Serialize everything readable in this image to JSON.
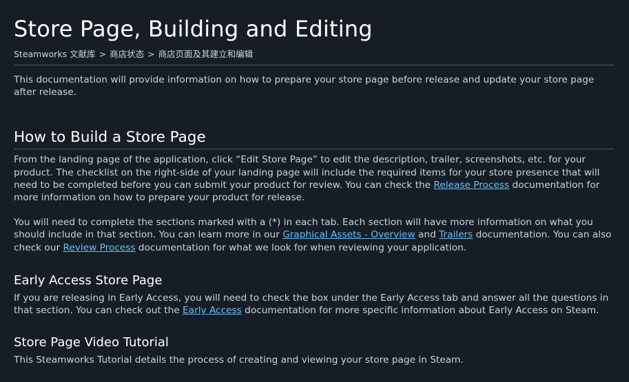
{
  "page": {
    "title": "Store Page, Building and Editing",
    "breadcrumb": [
      {
        "label": "Steamworks 文献库"
      },
      {
        "label": "商店状态"
      },
      {
        "label": "商店页面及其建立和编辑"
      }
    ],
    "breadcrumb_separator": ">",
    "intro": "This documentation will provide information on how to prepare your store page before release and update your store page after release."
  },
  "section_build": {
    "heading": "How to Build a Store Page",
    "p1_before": "From the landing page of the application, click “Edit Store Page” to edit the description, trailer, screenshots, etc. for your product. The checklist on the right-side of your landing page will include the required items for your store presence that will need to be completed before you can submit your product for review. You can check the ",
    "p1_link": "Release Process",
    "p1_after": " documentation for more information on how to prepare your product for release.",
    "p2_a": "You will need to complete the sections marked with a (*) in each tab. Each section will have more information on what you should include in that section. You can learn more in our ",
    "p2_link1": "Graphical Assets - Overview",
    "p2_b": " and ",
    "p2_link2": "Trailers",
    "p2_c": " documentation. You can also check our ",
    "p2_link3": "Review Process",
    "p2_d": " documentation for what we look for when reviewing your application."
  },
  "section_early": {
    "heading": "Early Access Store Page",
    "p_before": "If you are releasing in Early Access, you will need to check the box under the Early Access tab and answer all the questions in that section. You can check out the ",
    "p_link": "Early Access",
    "p_after": " documentation for more specific information about Early Access on Steam."
  },
  "section_video": {
    "heading": "Store Page Video Tutorial",
    "p": "This Steamworks Tutorial details the process of creating and viewing your store page in Steam."
  },
  "colors": {
    "background": "#171d25",
    "text": "#c6d4df",
    "heading": "#ffffff",
    "link": "#66c0f4",
    "divider": "#4b5663"
  }
}
